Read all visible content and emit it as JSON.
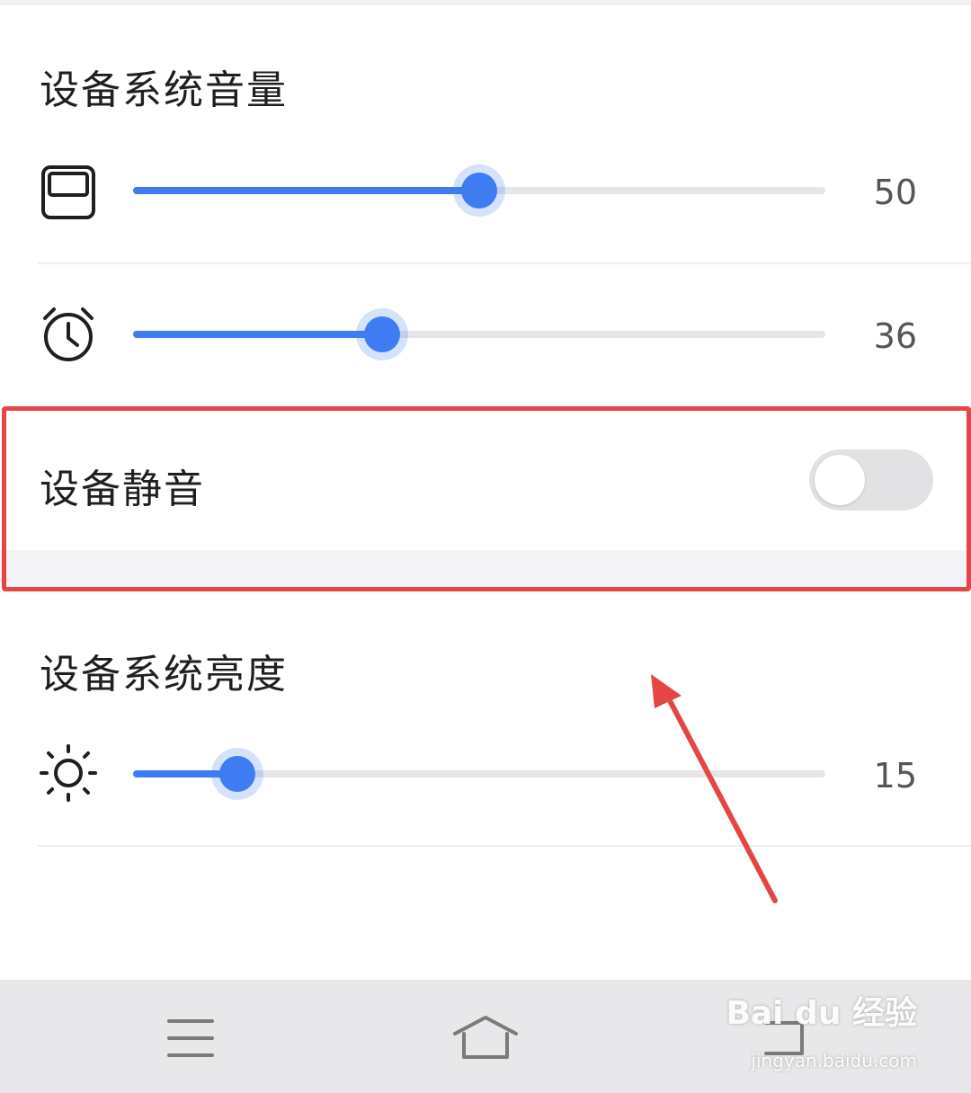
{
  "volume_section": {
    "title": "设备系统音量",
    "media_slider": {
      "icon": "media-screen-icon",
      "value": 50,
      "max": 100,
      "value_label": "50"
    },
    "alarm_slider": {
      "icon": "alarm-clock-icon",
      "value": 36,
      "max": 100,
      "value_label": "36"
    }
  },
  "mute_section": {
    "label": "设备静音",
    "toggle_on": false
  },
  "brightness_section": {
    "title": "设备系统亮度",
    "brightness_slider": {
      "icon": "sun-icon",
      "value": 15,
      "max": 100,
      "value_label": "15"
    }
  },
  "nav_bar": {
    "menu_icon": "menu-icon",
    "home_icon": "home-icon",
    "back_icon": "back-icon"
  },
  "watermark": {
    "logo_text": "Bai du 经验",
    "url_text": "jingyan.baidu.com"
  },
  "colors": {
    "accent": "#3f7cf2",
    "highlight_box": "#e64545",
    "annotation_arrow": "#e64545"
  }
}
